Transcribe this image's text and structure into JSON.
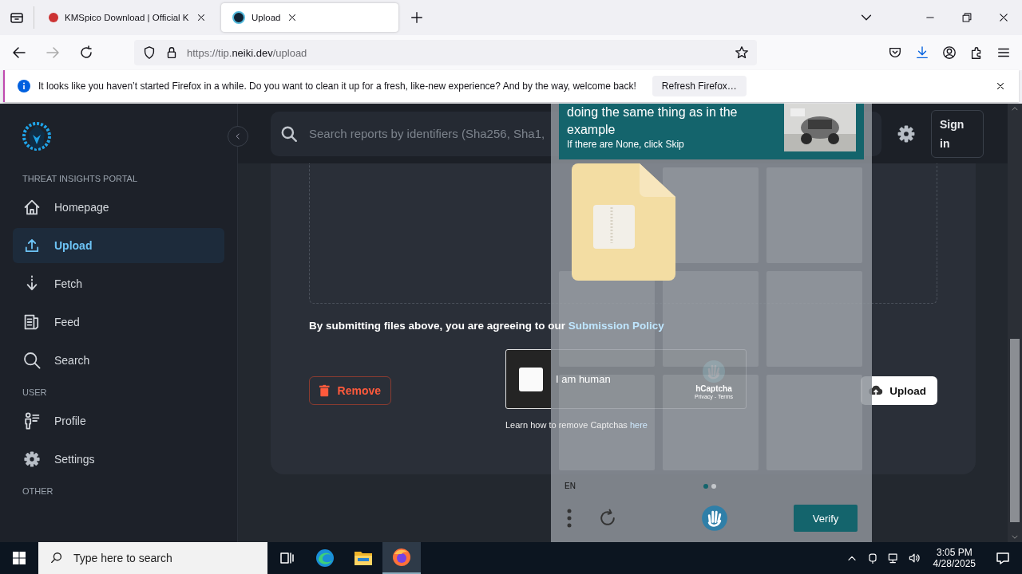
{
  "browser": {
    "tabs": [
      {
        "title": "KMSpico Download | Official K",
        "selected": false
      },
      {
        "title": "Upload",
        "selected": true
      }
    ],
    "url": {
      "prefix": "https://tip.",
      "domain": "neiki.dev",
      "path": "/upload"
    }
  },
  "notification": {
    "message": "It looks like you haven’t started Firefox in a while. Do you want to clean it up for a fresh, like-new experience? And by the way, welcome back!",
    "button": "Refresh Firefox…"
  },
  "sidebar": {
    "sections": [
      {
        "heading": "THREAT INSIGHTS PORTAL",
        "items": [
          {
            "label": "Homepage",
            "selected": false
          },
          {
            "label": "Upload",
            "selected": true
          },
          {
            "label": "Fetch",
            "selected": false
          },
          {
            "label": "Feed",
            "selected": false
          },
          {
            "label": "Search",
            "selected": false
          }
        ]
      },
      {
        "heading": "USER",
        "items": [
          {
            "label": "Profile",
            "selected": false
          },
          {
            "label": "Settings",
            "selected": false
          }
        ]
      },
      {
        "heading": "OTHER"
      }
    ]
  },
  "header": {
    "search_placeholder": "Search reports by identifiers (Sha256, Sha1,",
    "sign_in": "Sign in"
  },
  "upload": {
    "agreement": "By submitting files above, you are agreeing to our",
    "policy_link": "Submission Policy",
    "remove_button": "Remove",
    "upload_button": "Upload",
    "captcha": {
      "label": "I am human",
      "checked": false,
      "brand": "hCaptcha",
      "links": "Privacy - Terms"
    },
    "captcha_note": "Learn how to remove Captchas",
    "captcha_note_link": "here"
  },
  "challenge": {
    "prompt": "doing the same thing as in the example",
    "hint": "If there are None, click Skip",
    "language": "EN",
    "verify": "Verify",
    "pages": [
      {
        "selected": true
      },
      {
        "selected": false
      }
    ]
  },
  "taskbar": {
    "search_placeholder": "Type here to search",
    "time": "3:05 PM",
    "date": "4/28/2025"
  }
}
